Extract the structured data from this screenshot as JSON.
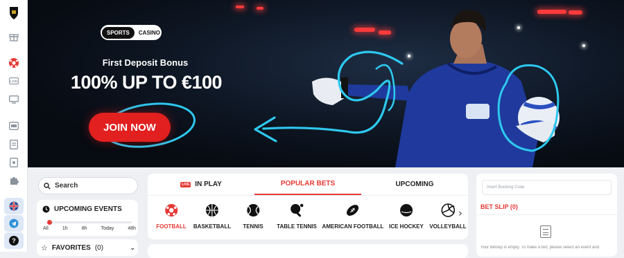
{
  "sidebar": {
    "items": [
      {
        "name": "logo",
        "icon": "crest-icon"
      },
      {
        "name": "gift",
        "icon": "gift-icon"
      },
      {
        "name": "sports",
        "icon": "football-icon",
        "active": true
      },
      {
        "name": "live",
        "icon": "live-icon"
      },
      {
        "name": "tv",
        "icon": "tv-icon"
      },
      {
        "name": "casino",
        "icon": "slot-icon"
      },
      {
        "name": "betting",
        "icon": "ticket-icon"
      },
      {
        "name": "promo",
        "icon": "card-icon"
      },
      {
        "name": "tools",
        "icon": "puzzle-icon"
      }
    ],
    "bottom": [
      "flag-uk-icon",
      "telegram-icon",
      "help-icon"
    ],
    "help_label": "?"
  },
  "hero": {
    "toggle": {
      "active": "SPORTS",
      "inactive": "CASINO"
    },
    "subtitle": "First Deposit Bonus",
    "title": "100% UP TO €100",
    "cta": "JOIN NOW"
  },
  "search": {
    "label": "Search"
  },
  "upcoming_events": {
    "title": "UPCOMING EVENTS",
    "options": [
      "All",
      "1h",
      "8h",
      "Today",
      "48h"
    ],
    "selected": "All"
  },
  "favorites": {
    "label": "FAVORITES",
    "count": "(0)"
  },
  "tabs": [
    {
      "label": "IN PLAY",
      "badge": "LIVE"
    },
    {
      "label": "POPULAR BETS",
      "active": true
    },
    {
      "label": "UPCOMING"
    }
  ],
  "sports": [
    {
      "label": "FOOTBALL",
      "icon": "football-icon",
      "active": true
    },
    {
      "label": "BASKETBALL",
      "icon": "basketball-icon"
    },
    {
      "label": "TENNIS",
      "icon": "tennis-icon"
    },
    {
      "label": "TABLE TENNIS",
      "icon": "table-tennis-icon"
    },
    {
      "label": "AMERICAN FOOTBALL",
      "icon": "american-football-icon"
    },
    {
      "label": "ICE HOCKEY",
      "icon": "ice-hockey-icon"
    },
    {
      "label": "VOLLEYBALL",
      "icon": "volleyball-icon"
    }
  ],
  "betslip": {
    "booking_placeholder": "Insert Booking Code",
    "title": "BET SLIP",
    "count": "(0)",
    "empty": "Your Betslip is empty. To make a bet, please select an event and"
  },
  "colors": {
    "accent": "#e53935",
    "hero_bg": "#070b12",
    "cta": "#e1201f",
    "scribble": "#2ec8ee"
  }
}
